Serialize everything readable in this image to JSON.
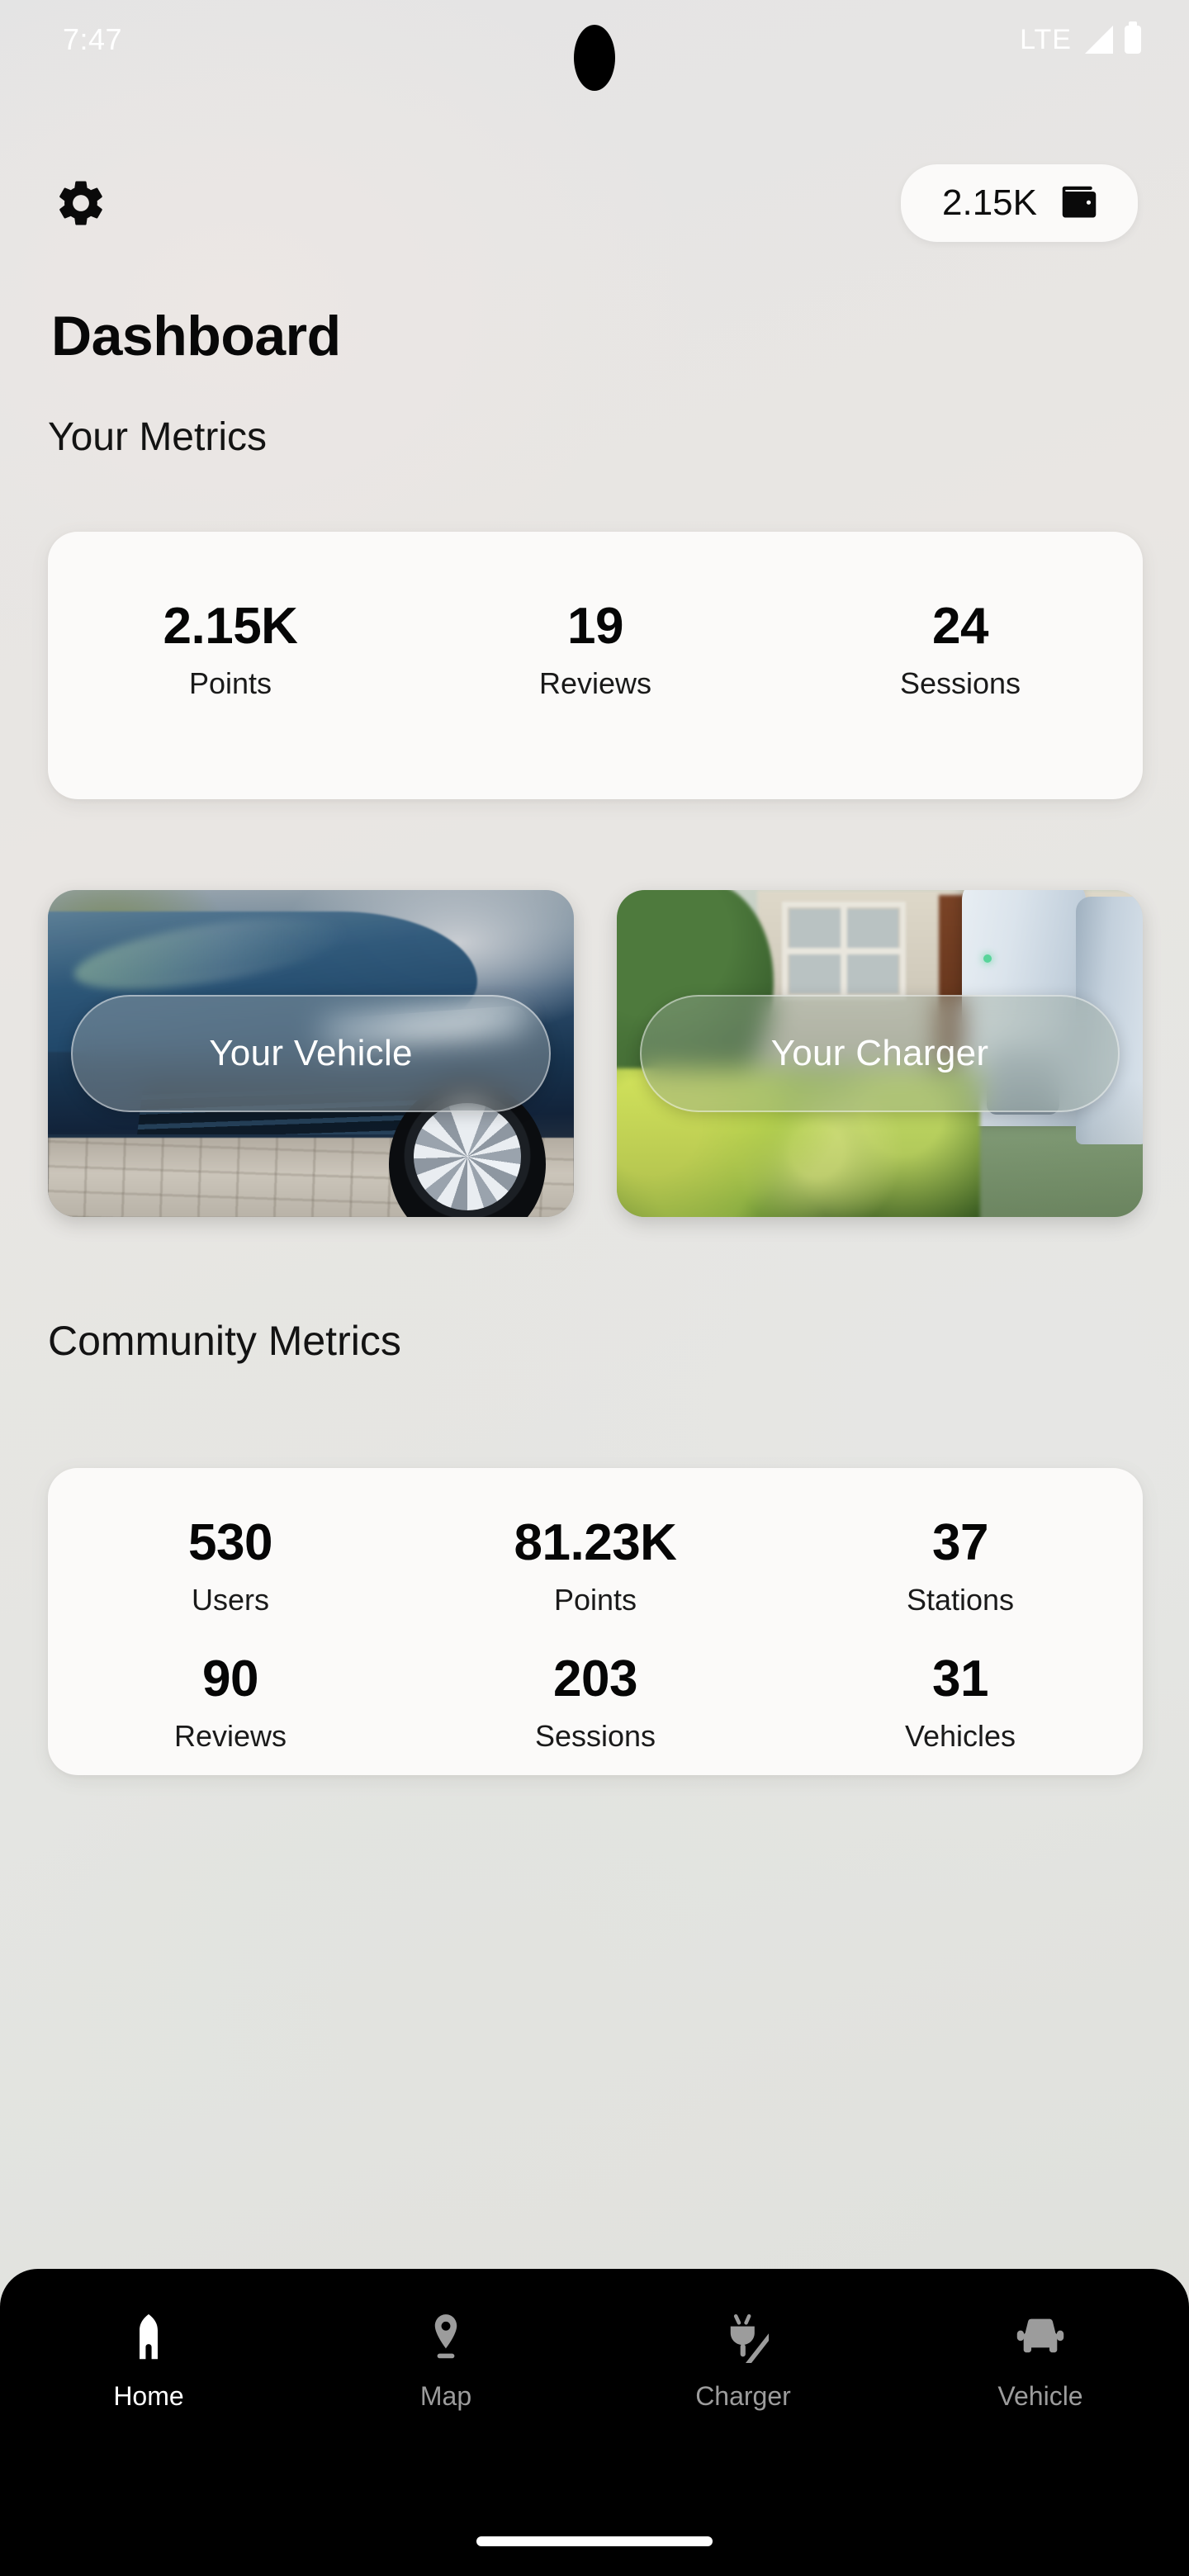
{
  "status_bar": {
    "time": "7:47",
    "network": "LTE",
    "signal_icon": "signal-bars-icon",
    "battery_icon": "battery-icon",
    "camera_icon": "camera-punch-hole"
  },
  "topbar": {
    "settings_icon": "gear-icon",
    "wallet": {
      "value": "2.15K",
      "icon": "wallet-icon"
    }
  },
  "page": {
    "title": "Dashboard"
  },
  "your_metrics": {
    "heading": "Your Metrics",
    "stats": [
      {
        "value": "2.15K",
        "label": "Points"
      },
      {
        "value": "19",
        "label": "Reviews"
      },
      {
        "value": "24",
        "label": "Sessions"
      }
    ]
  },
  "tiles": [
    {
      "label": "Your Vehicle",
      "image": "blue-electric-car-photo"
    },
    {
      "label": "Your Charger",
      "image": "home-ev-charger-photo"
    }
  ],
  "community_metrics": {
    "heading": "Community Metrics",
    "stats_row1": [
      {
        "value": "530",
        "label": "Users"
      },
      {
        "value": "81.23K",
        "label": "Points"
      },
      {
        "value": "37",
        "label": "Stations"
      }
    ],
    "stats_row2": [
      {
        "value": "90",
        "label": "Reviews"
      },
      {
        "value": "203",
        "label": "Sessions"
      },
      {
        "value": "31",
        "label": "Vehicles"
      }
    ]
  },
  "bottom_nav": {
    "items": [
      {
        "label": "Home",
        "icon": "home-icon",
        "active": true
      },
      {
        "label": "Map",
        "icon": "map-pin-icon",
        "active": false
      },
      {
        "label": "Charger",
        "icon": "charger-plug-icon",
        "active": false
      },
      {
        "label": "Vehicle",
        "icon": "car-icon",
        "active": false
      }
    ]
  },
  "colors": {
    "card_background": "#fbfaf9",
    "nav_background": "#000000",
    "nav_active": "#ffffff",
    "nav_inactive": "#9c9c9c",
    "text_primary": "#080808"
  }
}
